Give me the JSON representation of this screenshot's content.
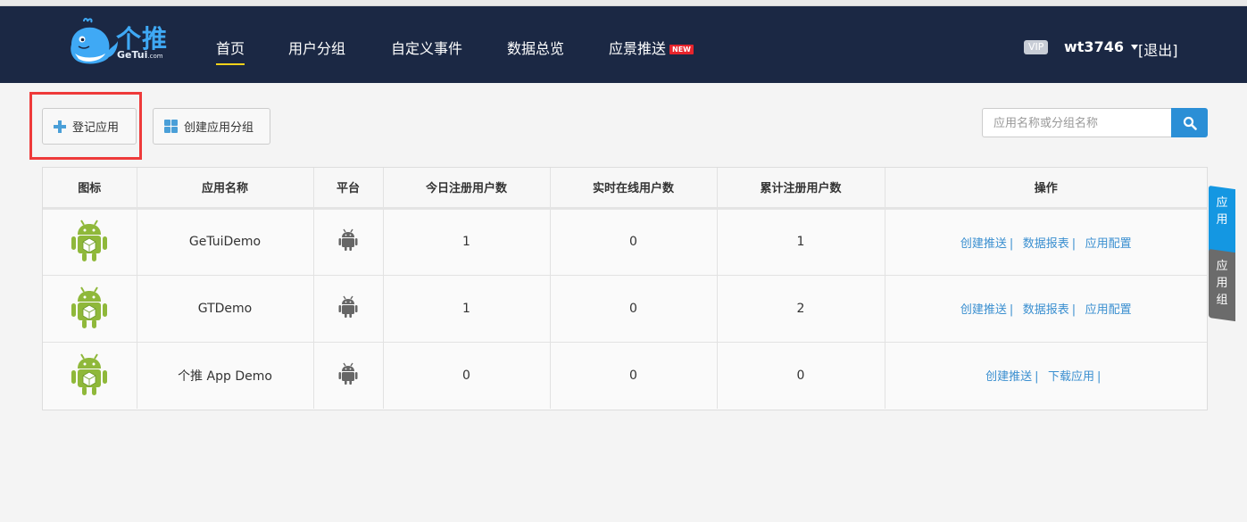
{
  "brand": {
    "name": "个推",
    "sub": "GeTui",
    "sub_small": ".com"
  },
  "nav": {
    "items": [
      {
        "label": "首页",
        "active": true
      },
      {
        "label": "用户分组"
      },
      {
        "label": "自定义事件"
      },
      {
        "label": "数据总览"
      },
      {
        "label": "应景推送",
        "badge": "NEW"
      }
    ]
  },
  "user": {
    "vip": "VIP",
    "name": "wt3746",
    "logout": "[退出]"
  },
  "toolbar": {
    "register_label": "登记应用",
    "create_group_label": "创建应用分组"
  },
  "search": {
    "placeholder": "应用名称或分组名称"
  },
  "table": {
    "headers": [
      "图标",
      "应用名称",
      "平台",
      "今日注册用户数",
      "实时在线用户数",
      "累计注册用户数",
      "操作"
    ],
    "rows": [
      {
        "name": "GeTuiDemo",
        "today": "1",
        "online": "0",
        "total": "1",
        "ops": [
          "创建推送",
          "数据报表",
          "应用配置"
        ]
      },
      {
        "name": "GTDemo",
        "today": "1",
        "online": "0",
        "total": "2",
        "ops": [
          "创建推送",
          "数据报表",
          "应用配置"
        ]
      },
      {
        "name": "个推 App Demo",
        "today": "0",
        "online": "0",
        "total": "0",
        "ops": [
          "创建推送",
          "下载应用"
        ]
      }
    ]
  },
  "side_tabs": {
    "app": [
      "应",
      "用"
    ],
    "group": [
      "应",
      "用",
      "组"
    ]
  },
  "colors": {
    "header_bg": "#1b2844",
    "accent": "#2b8fd6",
    "highlight": "#ee3a3a",
    "nav_active": "#f5d21a"
  }
}
